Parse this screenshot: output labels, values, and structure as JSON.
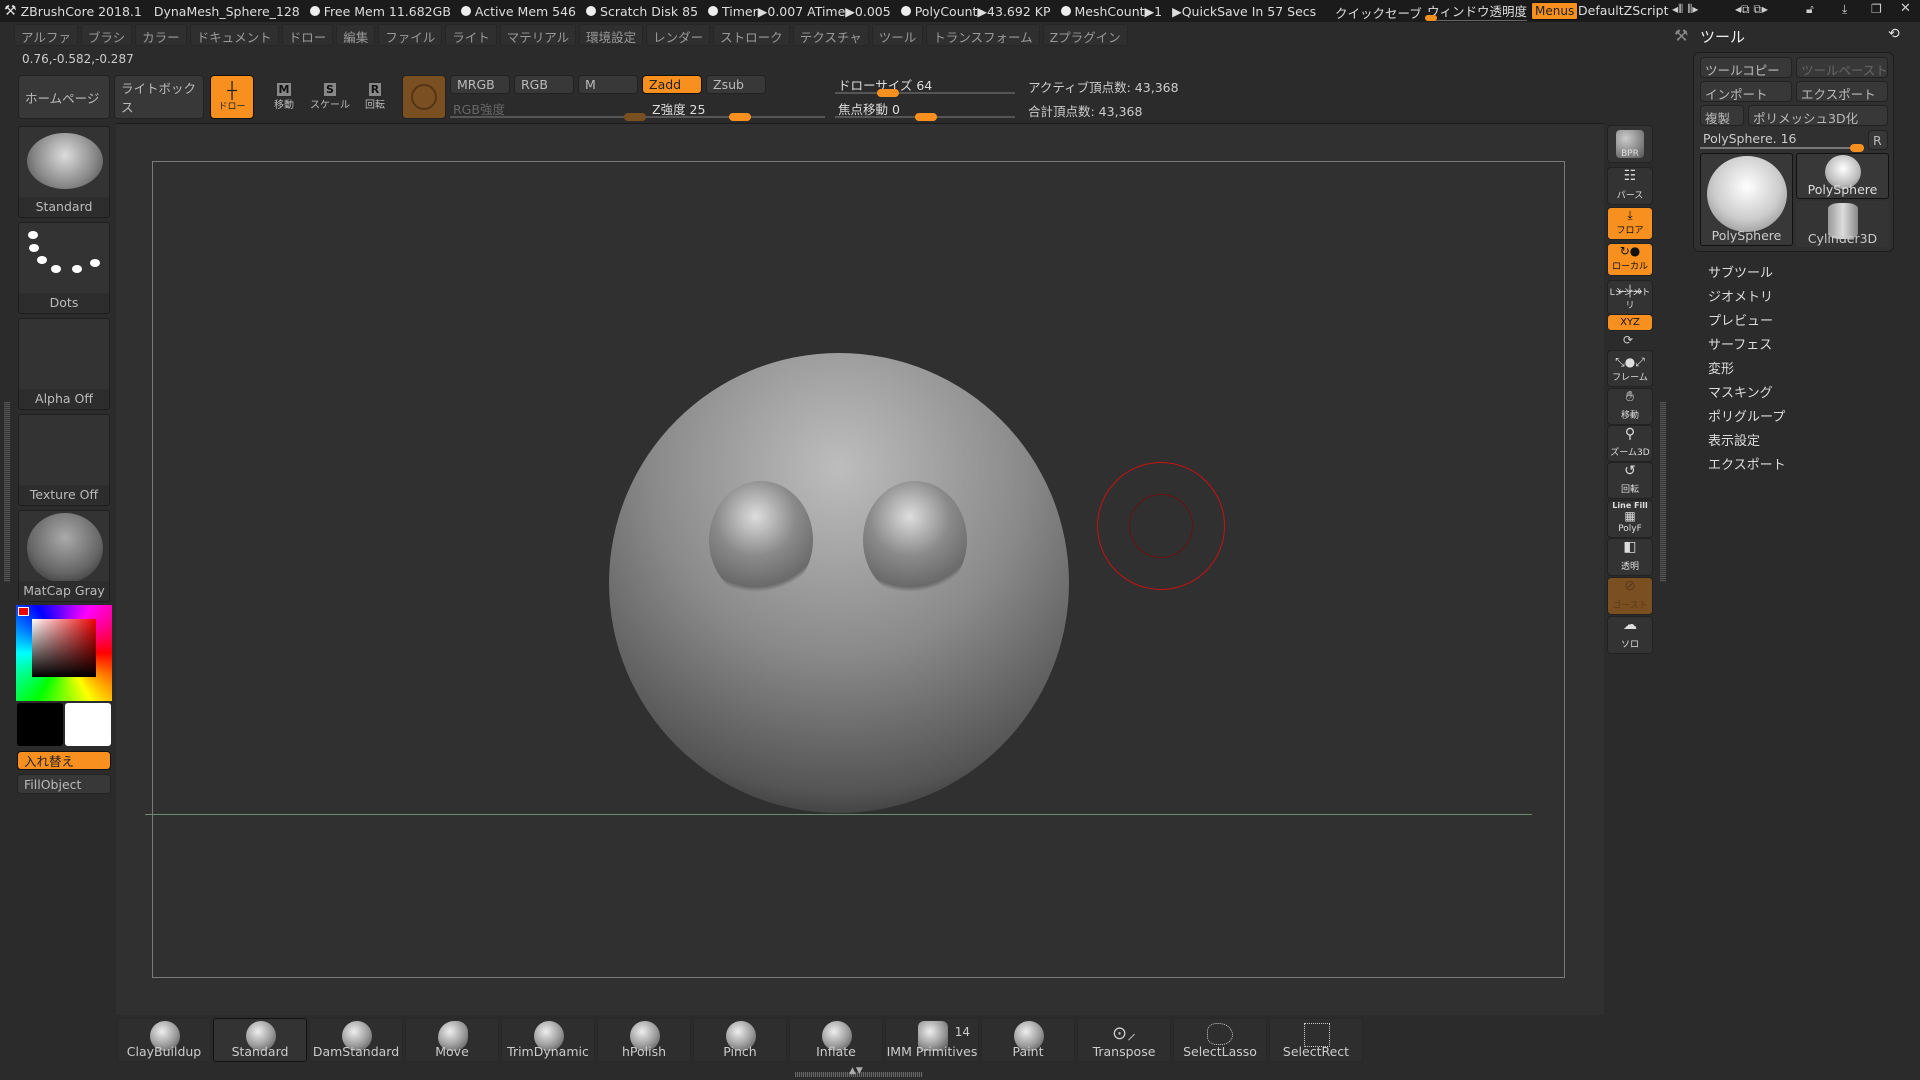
{
  "titlebar": {
    "app": "ZBrushCore 2018.1",
    "doc": "DynaMesh_Sphere_128",
    "stats": [
      "Free Mem 11.682GB",
      "Active Mem 546",
      "Scratch Disk 85",
      "Timer▶0.007 ATime▶0.005",
      "PolyCount▶43.692 KP",
      "MeshCount▶1"
    ],
    "quicksave_timer": "▶QuickSave In 57 Secs",
    "quicksave": "クイックセーブ",
    "transparency": "ウィンドウ透明度",
    "menus": "Menus",
    "script": "DefaultZScript"
  },
  "menubar": [
    "アルファ",
    "ブラシ",
    "カラー",
    "ドキュメント",
    "ドロー",
    "編集",
    "ファイル",
    "ライト",
    "マテリアル",
    "環境設定",
    "レンダー",
    "ストローク",
    "テクスチャ",
    "ツール",
    "トランスフォーム",
    "Zプラグイン"
  ],
  "coords": "0.76,-0.582,-0.287",
  "toolbar": {
    "home": "ホームページ",
    "lightbox": "ライトボックス",
    "draw": "ドロー",
    "move": "移動",
    "scale": "スケール",
    "rotate": "回転",
    "mrgb": "MRGB",
    "rgb": "RGB",
    "m": "M",
    "zadd": "Zadd",
    "zsub": "Zsub",
    "rgb_intensity": "RGB強度",
    "z_intensity": "Z強度 25",
    "draw_size": "ドローサイズ 64",
    "focal_shift": "焦点移動 0",
    "active_points": "アクティブ頂点数: 43,368",
    "total_points": "合計頂点数: 43,368"
  },
  "sliders": {
    "z_intensity": 25,
    "draw_size": 64,
    "focal_shift": 0
  },
  "left_shelf": {
    "brush": "Standard",
    "stroke": "Dots",
    "alpha": "Alpha Off",
    "texture": "Texture Off",
    "material": "MatCap Gray",
    "swap": "入れ替え",
    "fill": "FillObject",
    "main_color": "#000000",
    "secondary_color": "#ffffff"
  },
  "rail": [
    "BPR",
    "パース",
    "フロア",
    "ローカル",
    "Lシンメトリ",
    "XYZ",
    "フレーム",
    "移動",
    "ズーム3D",
    "回転",
    "PolyF",
    "透明",
    "ゴースト",
    "ソロ"
  ],
  "rail_extra": "Line Fill",
  "tool_panel": {
    "title": "ツール",
    "copy": "ツールコピー",
    "paste": "ツールペースト",
    "import": "インポート",
    "export": "エクスポート",
    "clone": "複製",
    "polymesh": "ポリメッシュ3D化",
    "current": "PolySphere. 16",
    "r": "R",
    "thumbs": [
      "PolySphere",
      "PolySphere",
      "Cylinder3D"
    ],
    "menu": [
      "サブツール",
      "ジオメトリ",
      "プレビュー",
      "サーフェス",
      "変形",
      "マスキング",
      "ポリグループ",
      "表示設定",
      "エクスポート"
    ]
  },
  "bottom_shelf": [
    "ClayBuildup",
    "Standard",
    "DamStandard",
    "Move",
    "TrimDynamic",
    "hPolish",
    "Pinch",
    "Inflate",
    "IMM Primitives",
    "Paint",
    "Transpose",
    "SelectLasso",
    "SelectRect"
  ],
  "imm_count": "14",
  "colors": {
    "accent": "#f7901e",
    "brush_cursor": "#cc1010"
  }
}
